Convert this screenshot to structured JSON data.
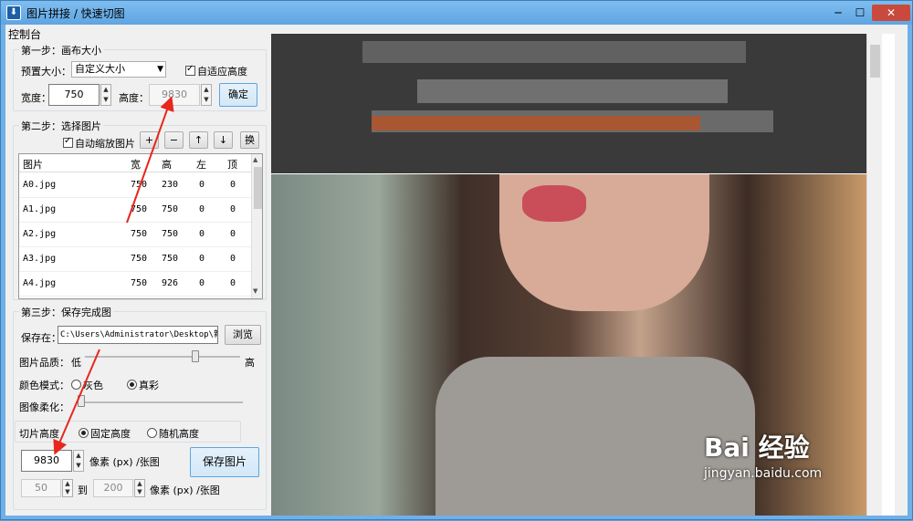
{
  "window": {
    "title": "图片拼接 / 快速切图",
    "minimize": "─",
    "maximize": "☐",
    "close": "✕"
  },
  "panel": {
    "label": "控制台"
  },
  "step1": {
    "legend": "第一步：画布大小",
    "preset_label": "预置大小：",
    "preset_value": "自定义大小",
    "auto_height_label": "自适应高度",
    "width_label": "宽度：",
    "width_value": "750",
    "height_label": "高度：",
    "height_value": "9830",
    "confirm": "确定"
  },
  "step2": {
    "legend": "第二步：选择图片",
    "auto_scale_label": "自动缩放图片",
    "add": "+",
    "remove": "−",
    "up": "↑",
    "down": "↓",
    "swap": "换",
    "columns": [
      "图片",
      "宽",
      "高",
      "左",
      "顶"
    ],
    "rows": [
      {
        "name": "A0.jpg",
        "w": "750",
        "h": "230",
        "l": "0",
        "t": "0"
      },
      {
        "name": "A1.jpg",
        "w": "750",
        "h": "750",
        "l": "0",
        "t": "0"
      },
      {
        "name": "A2.jpg",
        "w": "750",
        "h": "750",
        "l": "0",
        "t": "0"
      },
      {
        "name": "A3.jpg",
        "w": "750",
        "h": "750",
        "l": "0",
        "t": "0"
      },
      {
        "name": "A4.jpg",
        "w": "750",
        "h": "926",
        "l": "0",
        "t": "0"
      }
    ]
  },
  "step3": {
    "legend": "第三步：保存完成图",
    "save_to_label": "保存在：",
    "save_path": "C:\\Users\\Administrator\\Desktop\\新",
    "browse": "浏览",
    "quality_label": "图片品质：",
    "quality_low": "低",
    "quality_high": "高",
    "color_mode_label": "颜色模式：",
    "color_gray": "灰色",
    "color_true": "真彩",
    "soften_label": "图像柔化：",
    "slice_height_label": "切片高度",
    "fixed_height": "固定高度",
    "random_height": "随机高度",
    "slice_value": "9830",
    "pixel_unit": "像素 (px) /张图",
    "save_image": "保存图片",
    "range_from": "50",
    "range_to_label": "到",
    "range_to": "200",
    "range_unit": "像素 (px) /张图"
  },
  "watermark": {
    "brand": "Bai 经验",
    "url": "jingyan.baidu.com"
  }
}
